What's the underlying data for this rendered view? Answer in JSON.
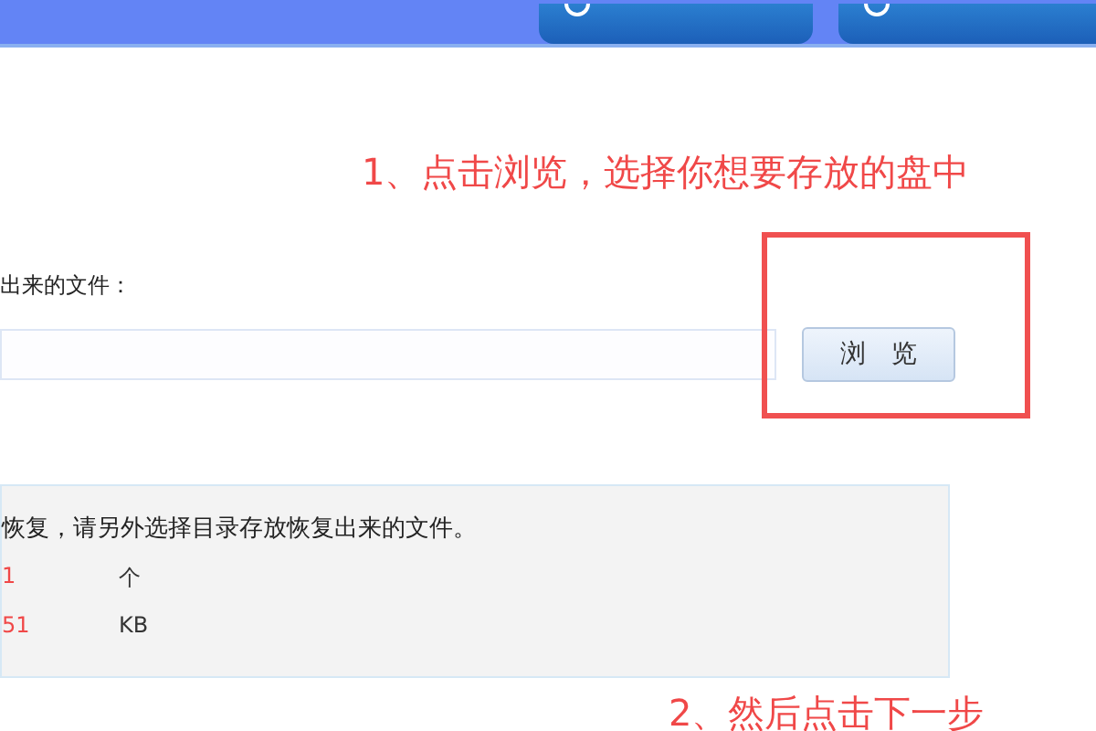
{
  "top_bar": {
    "buttons": [
      {
        "kind": "tab"
      },
      {
        "kind": "tab"
      }
    ]
  },
  "annotations": [
    "1、点击浏览，选择你想要存放的盘中",
    "2、然后点击下一步"
  ],
  "form": {
    "label": "出来的文件：",
    "browse_button": "浏　览"
  },
  "info_panel": {
    "message": "恢复，请另外选择目录存放恢复出来的文件。",
    "rows": [
      {
        "value": "1",
        "unit": "个"
      },
      {
        "value": "51",
        "unit": "KB"
      }
    ]
  }
}
